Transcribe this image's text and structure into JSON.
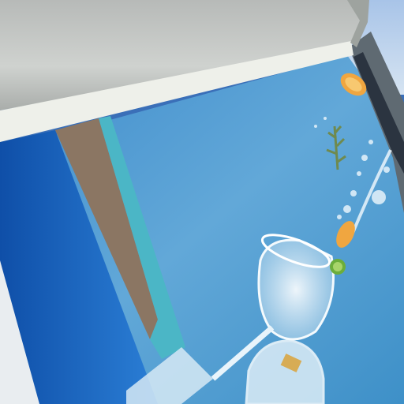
{
  "scene": {
    "kind": "photo",
    "subject": "billboard-corner-with-gin-glass-advert",
    "colors": {
      "sky": "#b9d0ea",
      "frame_grey": "#c9ccc9",
      "frame_shadow": "#8f9390",
      "frame_highlight": "#f2f2ee",
      "poster_sky": "#5ea4d6",
      "poster_deep": "#1557b0",
      "poster_mid": "#2a7ad0",
      "poster_brown": "#8a7360",
      "poster_teal": "#46b4c8",
      "glass_white": "#eef6fb",
      "orange_slice": "#f0a640",
      "lime": "#6cae3a",
      "rosemary": "#6f8a4e"
    },
    "icons": [
      "frame-icon",
      "glass-icon",
      "orange-slice-icon",
      "lime-icon",
      "rosemary-icon"
    ]
  }
}
